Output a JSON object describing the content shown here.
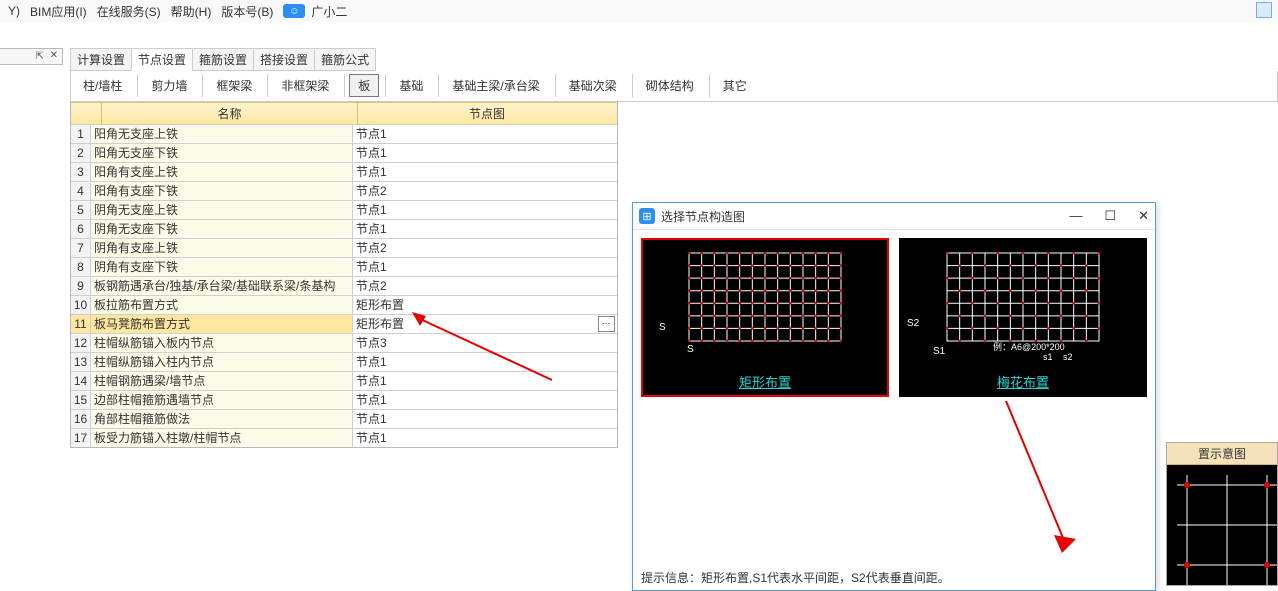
{
  "menubar": {
    "items": [
      "Y)",
      "BIM应用(I)",
      "在线服务(S)",
      "帮助(H)",
      "版本号(B)"
    ],
    "assistant": "广小二"
  },
  "ribbon": {
    "tabs": [
      "计算设置",
      "节点设置",
      "箍筋设置",
      "搭接设置",
      "箍筋公式"
    ],
    "selected": 1,
    "sub": [
      "柱/墙柱",
      "剪力墙",
      "框架梁",
      "非框架梁",
      "板",
      "基础",
      "基础主梁/承台梁",
      "基础次梁",
      "砌体结构",
      "其它"
    ],
    "sub_selected": 4
  },
  "table": {
    "col_name": "名称",
    "col_node": "节点图",
    "rows": [
      {
        "n": "1",
        "name": "阳角无支座上铁",
        "node": "节点1"
      },
      {
        "n": "2",
        "name": "阳角无支座下铁",
        "node": "节点1"
      },
      {
        "n": "3",
        "name": "阳角有支座上铁",
        "node": "节点1"
      },
      {
        "n": "4",
        "name": "阳角有支座下铁",
        "node": "节点2"
      },
      {
        "n": "5",
        "name": "阴角无支座上铁",
        "node": "节点1"
      },
      {
        "n": "6",
        "name": "阴角无支座下铁",
        "node": "节点1"
      },
      {
        "n": "7",
        "name": "阴角有支座上铁",
        "node": "节点2"
      },
      {
        "n": "8",
        "name": "阴角有支座下铁",
        "node": "节点1"
      },
      {
        "n": "9",
        "name": "板钢筋遇承台/独基/承台梁/基础联系梁/条基构",
        "node": "节点2"
      },
      {
        "n": "10",
        "name": "板拉筋布置方式",
        "node": "矩形布置"
      },
      {
        "n": "11",
        "name": "板马凳筋布置方式",
        "node": "矩形布置"
      },
      {
        "n": "12",
        "name": "柱帽纵筋锚入板内节点",
        "node": "节点3"
      },
      {
        "n": "13",
        "name": "柱帽纵筋锚入柱内节点",
        "node": "节点1"
      },
      {
        "n": "14",
        "name": "柱帽钢筋遇梁/墙节点",
        "node": "节点1"
      },
      {
        "n": "15",
        "name": "边部柱帽箍筋遇墙节点",
        "node": "节点1"
      },
      {
        "n": "16",
        "name": "角部柱帽箍筋做法",
        "node": "节点1"
      },
      {
        "n": "17",
        "name": "板受力筋锚入柱墩/柱帽节点",
        "node": "节点1"
      }
    ],
    "selected": 10
  },
  "dialog": {
    "title": "选择节点构造图",
    "options": [
      {
        "label": "矩形布置",
        "axis_v": "S",
        "axis_h": "S"
      },
      {
        "label": "梅花布置",
        "axis_v": "S2",
        "axis_h": "S1",
        "example": "例：A6@200*200",
        "sub1": "s1",
        "sub2": "s2"
      }
    ],
    "selected": 0,
    "hint_prefix": "提示信息：",
    "hint_body": "矩形布置,S1代表水平间距，S2代表垂直间距。"
  },
  "minipanel": {
    "caption": "置示意图"
  }
}
